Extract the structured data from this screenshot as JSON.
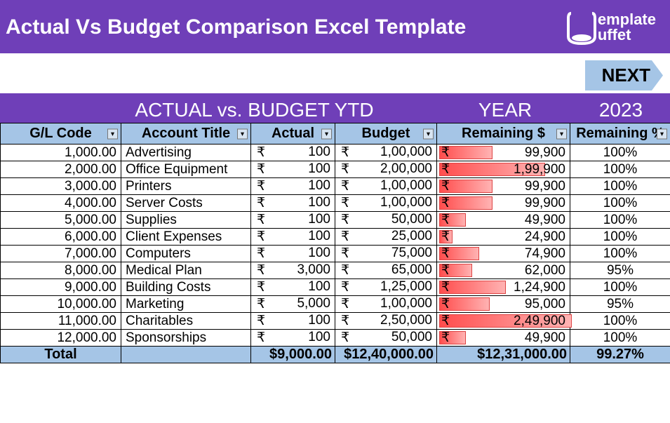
{
  "header": {
    "title": "Actual Vs Budget Comparison Excel Template",
    "logo_top": "emplate",
    "logo_bottom": "uffet"
  },
  "nav": {
    "next": "NEXT"
  },
  "subheader": {
    "main": "ACTUAL vs. BUDGET YTD",
    "year_label": "YEAR",
    "year_value": "2023"
  },
  "columns": {
    "c1": "G/L Code",
    "c2": "Account Title",
    "c3": "Actual",
    "c4": "Budget",
    "c5": "Remaining $",
    "c6": "Remaining %"
  },
  "currency": "₹",
  "rows": [
    {
      "code": "1,000.00",
      "title": "Advertising",
      "actual": "100",
      "budget": "1,00,000",
      "remain": "99,900",
      "pct": "100%",
      "bar": 40
    },
    {
      "code": "2,000.00",
      "title": "Office Equipment",
      "actual": "100",
      "budget": "2,00,000",
      "remain": "1,99,900",
      "pct": "100%",
      "bar": 80
    },
    {
      "code": "3,000.00",
      "title": "Printers",
      "actual": "100",
      "budget": "1,00,000",
      "remain": "99,900",
      "pct": "100%",
      "bar": 40
    },
    {
      "code": "4,000.00",
      "title": "Server Costs",
      "actual": "100",
      "budget": "1,00,000",
      "remain": "99,900",
      "pct": "100%",
      "bar": 40
    },
    {
      "code": "5,000.00",
      "title": "Supplies",
      "actual": "100",
      "budget": "50,000",
      "remain": "49,900",
      "pct": "100%",
      "bar": 20
    },
    {
      "code": "6,000.00",
      "title": "Client Expenses",
      "actual": "100",
      "budget": "25,000",
      "remain": "24,900",
      "pct": "100%",
      "bar": 10
    },
    {
      "code": "7,000.00",
      "title": "Computers",
      "actual": "100",
      "budget": "75,000",
      "remain": "74,900",
      "pct": "100%",
      "bar": 30
    },
    {
      "code": "8,000.00",
      "title": "Medical Plan",
      "actual": "3,000",
      "budget": "65,000",
      "remain": "62,000",
      "pct": "95%",
      "bar": 25
    },
    {
      "code": "9,000.00",
      "title": "Building Costs",
      "actual": "100",
      "budget": "1,25,000",
      "remain": "1,24,900",
      "pct": "100%",
      "bar": 50
    },
    {
      "code": "10,000.00",
      "title": "Marketing",
      "actual": "5,000",
      "budget": "1,00,000",
      "remain": "95,000",
      "pct": "95%",
      "bar": 38
    },
    {
      "code": "11,000.00",
      "title": "Charitables",
      "actual": "100",
      "budget": "2,50,000",
      "remain": "2,49,900",
      "pct": "100%",
      "bar": 100
    },
    {
      "code": "12,000.00",
      "title": "Sponsorships",
      "actual": "100",
      "budget": "50,000",
      "remain": "49,900",
      "pct": "100%",
      "bar": 20
    }
  ],
  "totals": {
    "label": "Total",
    "actual": "$9,000.00",
    "budget": "$12,40,000.00",
    "remain": "$12,31,000.00",
    "pct": "99.27%"
  }
}
